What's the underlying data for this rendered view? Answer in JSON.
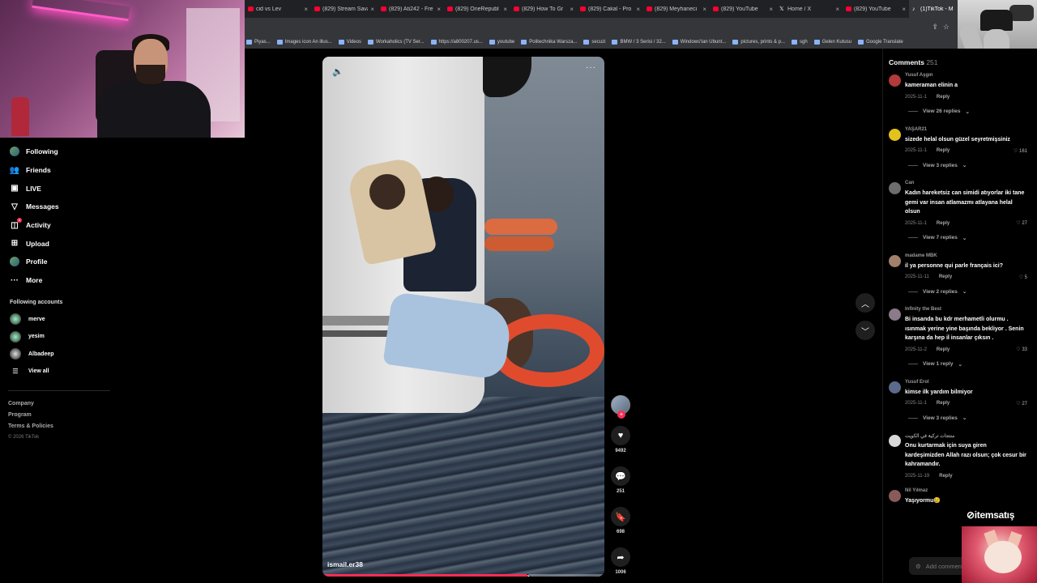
{
  "browser": {
    "tabs": [
      {
        "title": "cid vs Lev",
        "icon": "youtube-icon"
      },
      {
        "title": "(829) Stream Sava",
        "icon": "youtube-icon"
      },
      {
        "title": "(829) Ati242 - Fre",
        "icon": "youtube-icon"
      },
      {
        "title": "(829) OneRepubl",
        "icon": "youtube-icon"
      },
      {
        "title": "(829) How To Gr",
        "icon": "youtube-icon"
      },
      {
        "title": "(829) Cakal - Pro",
        "icon": "youtube-icon"
      },
      {
        "title": "(829) Meyhaneci",
        "icon": "youtube-icon"
      },
      {
        "title": "(829) YouTube",
        "icon": "youtube-icon"
      },
      {
        "title": "Home / X",
        "icon": "x-icon"
      },
      {
        "title": "(829) YouTube",
        "icon": "youtube-icon"
      },
      {
        "title": "(1)TikTok - M",
        "icon": "tiktok-icon",
        "active": true
      }
    ],
    "bookmarks": [
      "Piyas...",
      "Images icon An illus...",
      "Videos",
      "Workaholics (TV Ser...",
      "https://a800207.us...",
      "youtube",
      "Politechnika Warsza...",
      "secuzi",
      "BMW / 3 Serisi / 32...",
      "Windows'tan Ubunt...",
      "pictures, prints & p...",
      "sgh",
      "Gelen Kutusu",
      "Google Translate"
    ]
  },
  "sidebar": {
    "nav": [
      {
        "label": "Following",
        "icon": "following-avatar-icon"
      },
      {
        "label": "Friends",
        "icon": "friends-icon"
      },
      {
        "label": "LIVE",
        "icon": "live-icon"
      },
      {
        "label": "Messages",
        "icon": "messages-icon"
      },
      {
        "label": "Activity",
        "icon": "activity-icon",
        "badge": "1"
      },
      {
        "label": "Upload",
        "icon": "upload-icon"
      },
      {
        "label": "Profile",
        "icon": "profile-avatar-icon"
      },
      {
        "label": "More",
        "icon": "more-icon"
      }
    ],
    "following_title": "Following accounts",
    "accounts": [
      "merve",
      "yesim",
      "Albadeep"
    ],
    "view_all": "View all",
    "footer": [
      "Company",
      "Program",
      "Terms & Policies"
    ],
    "copyright": "© 2026 TikTok"
  },
  "video": {
    "author": "ismail.er38",
    "progress": 0.73
  },
  "actions": {
    "likes": "9492",
    "comments": "251",
    "saves": "698",
    "shares": "1006"
  },
  "comments_panel": {
    "title": "Comments",
    "count": "251",
    "items": [
      {
        "user": "Yusuf Aşgın",
        "text": "kameraman elinin a",
        "date": "2025-11-1",
        "reply": "Reply",
        "likes": "",
        "view": "View 26 replies",
        "avatar": "#b23a3a"
      },
      {
        "user": "YAŞAR21",
        "text": "sizede helal olsun güzel seyretmişsiniz",
        "date": "2025-11-1",
        "reply": "Reply",
        "likes": "161",
        "view": "View 3 replies",
        "avatar": "#e3c21c"
      },
      {
        "user": "Can",
        "text": "Kadın hareketsiz can simidi atıyorlar iki tane gemi var insan atlamazmı atlayana helal olsun",
        "date": "2025-11-1",
        "reply": "Reply",
        "likes": "27",
        "view": "View 7 replies",
        "avatar": "#6d6d6d"
      },
      {
        "user": "madame MBK",
        "text": "il ya personne qui parle français ici?",
        "date": "2025-11-11",
        "reply": "Reply",
        "likes": "5",
        "view": "View 2 replies",
        "avatar": "#a0806a"
      },
      {
        "user": "Infinity the Best",
        "text": "Bi insanda bu kdr merhametli olurmu . ısınmak yerine yine başında bekliyor . Senin karşına da hep iİ insanlar çıksın .",
        "date": "2025-11-2",
        "reply": "Reply",
        "likes": "33",
        "view": "View 1 reply",
        "avatar": "#8a7a8a"
      },
      {
        "user": "Yusuf Erol",
        "text": "kimse ilk yardım bilmiyor",
        "date": "2025-11-1",
        "reply": "Reply",
        "likes": "27",
        "view": "View 3 replies",
        "avatar": "#5a6a8a"
      },
      {
        "user": "منتجات تركية في الكويت",
        "text": "Onu kurtarmak için suya giren kardeşimizden Allah razı olsun; çok cesur bir kahramandır.",
        "date": "2025-11-19",
        "reply": "Reply",
        "likes": "",
        "view": "",
        "avatar": "#d8d8d8"
      },
      {
        "user": "Nil Yılmaz",
        "text": "Yaşıyormu😢",
        "date": "",
        "reply": "",
        "likes": "",
        "view": "",
        "avatar": "#8a5a5a"
      }
    ],
    "add_placeholder": "Add comment..."
  },
  "overlay": {
    "watermark": "itemsatış"
  }
}
